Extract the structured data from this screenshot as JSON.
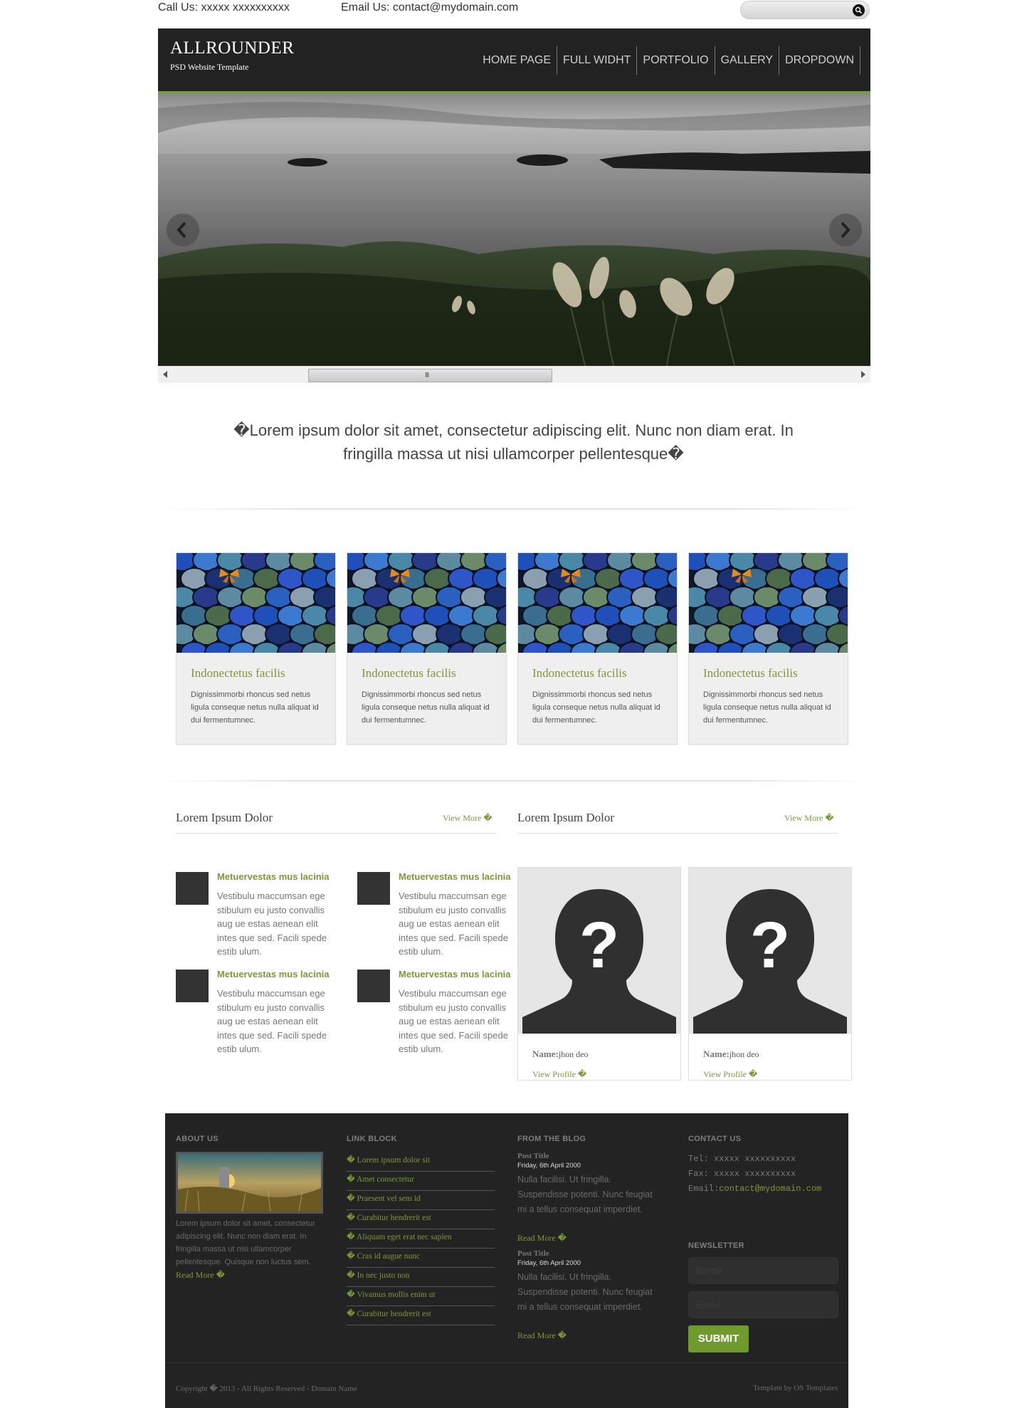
{
  "topbar": {
    "phone": "Call Us: xxxxx xxxxxxxxxx",
    "email": "Email Us: contact@mydomain.com"
  },
  "header": {
    "logo": "ALLROUNDER",
    "tagline": "PSD Website Template",
    "nav": [
      "HOME PAGE",
      "FULL WIDHT",
      "PORTFOLIO",
      "GALLERY",
      "DROPDOWN"
    ]
  },
  "slider": {
    "scroll_grip": "III"
  },
  "quote": "�Lorem ipsum dolor sit amet, consectetur adipiscing elit. Nunc non diam erat. In fringilla massa ut nisi ullamcorper pellentesque�",
  "cards": [
    {
      "title": "Indonectetus facilis",
      "text": "Dignissimmorbi rhoncus sed netus ligula conseque netus nulla aliquat id dui fermentumnec."
    },
    {
      "title": "Indonectetus facilis",
      "text": "Dignissimmorbi rhoncus sed netus ligula conseque netus nulla aliquat id dui fermentumnec."
    },
    {
      "title": "Indonectetus facilis",
      "text": "Dignissimmorbi rhoncus sed netus ligula conseque netus nulla aliquat id dui fermentumnec."
    },
    {
      "title": "Indonectetus facilis",
      "text": "Dignissimmorbi rhoncus sed netus ligula conseque netus nulla aliquat id dui fermentumnec."
    }
  ],
  "section_left": {
    "title": "Lorem Ipsum Dolor",
    "view_more": "View More �",
    "items": [
      {
        "title": "Metuervestas mus lacinia",
        "text": "Vestibulu maccumsan ege stibulum eu justo convallis aug ue estas aenean elit intes que sed. Facili spede estib ulum."
      },
      {
        "title": "Metuervestas mus lacinia",
        "text": "Vestibulu maccumsan ege stibulum eu justo convallis aug ue estas aenean elit intes que sed. Facili spede estib ulum."
      },
      {
        "title": "Metuervestas mus lacinia",
        "text": "Vestibulu maccumsan ege stibulum eu justo convallis aug ue estas aenean elit intes que sed. Facili spede estib ulum."
      },
      {
        "title": "Metuervestas mus lacinia",
        "text": "Vestibulu maccumsan ege stibulum eu justo convallis aug ue estas aenean elit intes que sed. Facili spede estib ulum."
      }
    ]
  },
  "section_right": {
    "title": "Lorem Ipsum Dolor",
    "view_more": "View More �",
    "profiles": [
      {
        "name_label": "Name:",
        "name": "jhon deo",
        "link": "View Profile �"
      },
      {
        "name_label": "Name:",
        "name": "jhon deo",
        "link": "View Profile �"
      }
    ]
  },
  "footer": {
    "about": {
      "heading": "ABOUT US",
      "text": "Lorem ipsum dolor sit amet, consectetur adipiscing elit. Nunc non diam erat. In fringilla massa ut nisi ullamcorper pellentesque. Quisque non luctus sem.",
      "read_more": "Read More �"
    },
    "links": {
      "heading": "LINK BLOCK",
      "items": [
        "� Lorem ipsum dolor sit",
        "� Amet consectetur",
        "� Praesent vel sem id",
        "� Curabitur hendrerit est",
        "� Aliquam eget erat nec sapien",
        "� Cras id augue nunc",
        "� In nec justo non",
        "� Vivamus mollis enim ut",
        "� Curabitur hendrerit est"
      ]
    },
    "blog": {
      "heading": "FROM THE BLOG",
      "posts": [
        {
          "title": "Post Title",
          "date": "Friday, 6th April 2000",
          "text": "Nulla facilisi. Ut fringilla. Suspendisse potenti. Nunc feugiat mi a tellus consequat imperdiet.",
          "read_more": "Read More �"
        },
        {
          "title": "Post Title",
          "date": "Friday, 6th April 2000",
          "text": "Nulla facilisi. Ut fringilla. Suspendisse potenti. Nunc feugiat mi a tellus consequat imperdiet.",
          "read_more": "Read More �"
        }
      ]
    },
    "contact": {
      "heading": "CONTACT US",
      "tel": "Tel: xxxxx xxxxxxxxxx",
      "fax": "Fax: xxxxx xxxxxxxxxx",
      "email_label": "Email:",
      "email": "contact@mydomain.com"
    },
    "newsletter": {
      "heading": "NEWSLETTER",
      "name_placeholder": "Name",
      "email_placeholder": "Email",
      "submit": "SUBMIT"
    },
    "copyright": "Copyright � 2013 - All Rights Reserved - Domain Name",
    "credit": "Template by OS Templates"
  }
}
